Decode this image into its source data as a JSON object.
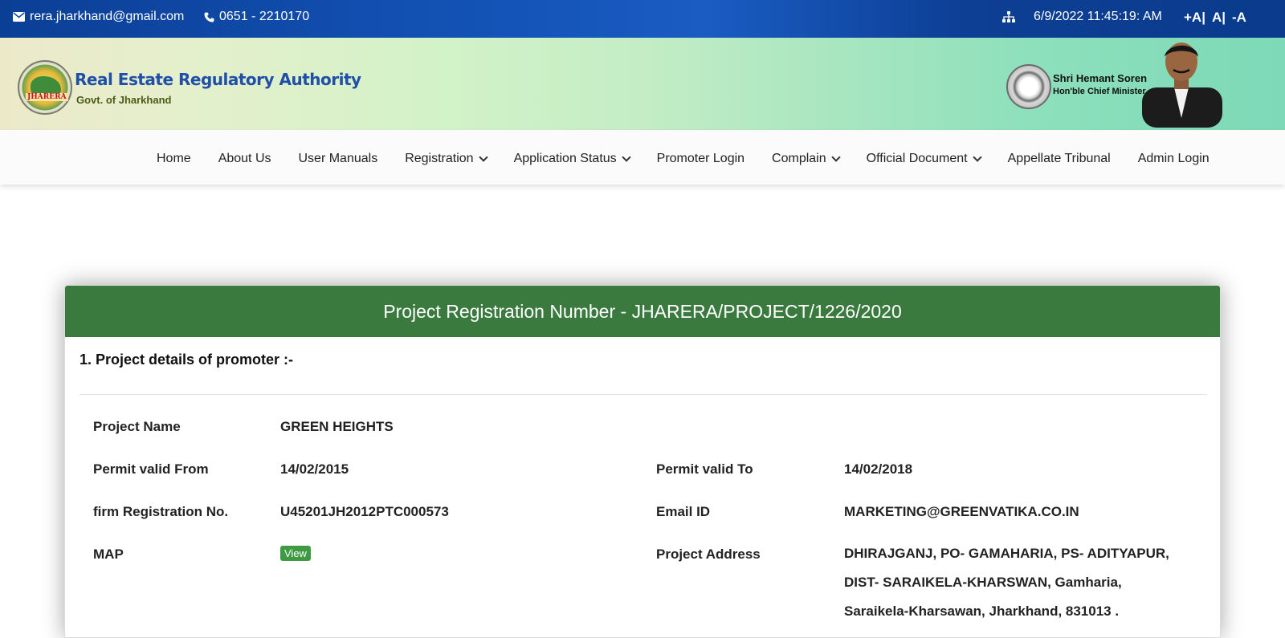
{
  "topbar": {
    "email": "rera.jharkhand@gmail.com",
    "phone": "0651 - 2210170",
    "datetime": "6/9/2022 11:45:19: AM",
    "font_increase": "+A|",
    "font_normal": "A|",
    "font_decrease": "-A"
  },
  "banner": {
    "logo_tag": "JHARERA",
    "title": "Real Estate Regulatory Authority",
    "subtitle": "Govt. of Jharkhand",
    "cm_name": "Shri Hemant Soren",
    "cm_role": "Hon'ble Chief Minister"
  },
  "nav": {
    "home": "Home",
    "about": "About Us",
    "manuals": "User Manuals",
    "registration": "Registration",
    "app_status": "Application Status",
    "promoter_login": "Promoter Login",
    "complain": "Complain",
    "official_document": "Official Document",
    "appellate": "Appellate Tribunal",
    "admin_login": "Admin Login"
  },
  "card": {
    "header": "Project Registration Number - JHARERA/PROJECT/1226/2020",
    "section_title": "1. Project details of promoter :-",
    "project_name_label": "Project Name",
    "project_name": "GREEN HEIGHTS",
    "permit_from_label": "Permit valid From",
    "permit_from": "14/02/2015",
    "permit_to_label": "Permit valid To",
    "permit_to": "14/02/2018",
    "firm_reg_label": "firm Registration No.",
    "firm_reg": "U45201JH2012PTC000573",
    "email_label": "Email ID",
    "email": "MARKETING@GREENVATIKA.CO.IN",
    "map_label": "MAP",
    "map_button": "View",
    "address_label": "Project Address",
    "address": "DHIRAJGANJ, PO- GAMAHARIA, PS- ADITYAPUR, DIST- SARAIKELA-KHARSWAN, Gamharia, Saraikela-Kharsawan, Jharkhand, 831013 ."
  }
}
